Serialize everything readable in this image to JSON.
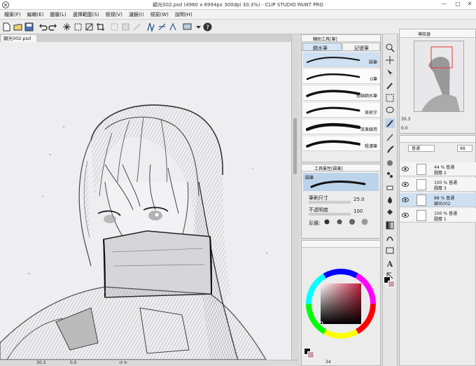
{
  "window": {
    "title": "穎光002.psd (4980 x 6994px 300dpi 30.3%)  - CLIP STUDIO PAINT PRO",
    "minimize": "—",
    "maximize": "□",
    "close": "✕"
  },
  "menu": [
    "檔案(F)",
    "編輯(E)",
    "圖層(L)",
    "選擇範圍(S)",
    "檢視(V)",
    "濾鏡(I)",
    "視窗(W)",
    "說明(H)"
  ],
  "document_tab": "穎光002.psd",
  "statusbar": {
    "zoom": "30.3",
    "angle": "0.0"
  },
  "subtool_panel": {
    "tabs": [
      "輔助工具[筆]"
    ],
    "groups": [
      "鋼水筆",
      "記號筆"
    ],
    "brushes": [
      "圓筆",
      "G筆",
      "粗線鋼水筆",
      "美術字",
      "效果線用",
      "粗濃筆"
    ]
  },
  "tool_property": {
    "tab": "工具屬性[圓筆]",
    "name": "圓筆",
    "brush_size_label": "筆刷尺寸",
    "brush_size": "25.0",
    "opacity_label": "不透明度",
    "opacity": "100",
    "antialias_label": "反鋸:"
  },
  "color_panel": {
    "hue_value": "34",
    "selected_color": "#7a2535"
  },
  "navigator": {
    "tab": "導航器",
    "zoom": "30.3",
    "angle": "0.0"
  },
  "layer_panel": {
    "blend_mode": "普通",
    "opacity": "88",
    "layers": [
      {
        "line1": "44 % 普通",
        "line2": "圖層 2"
      },
      {
        "line1": "100 % 普通",
        "line2": "圖層 3"
      },
      {
        "line1": "88 % 普通",
        "line2": "穎光002"
      },
      {
        "line1": "100 % 普通",
        "line2": "圖層 1"
      }
    ]
  },
  "colors": {
    "accent": "#3c78c8",
    "selected_layer": "#cfe0f2"
  }
}
